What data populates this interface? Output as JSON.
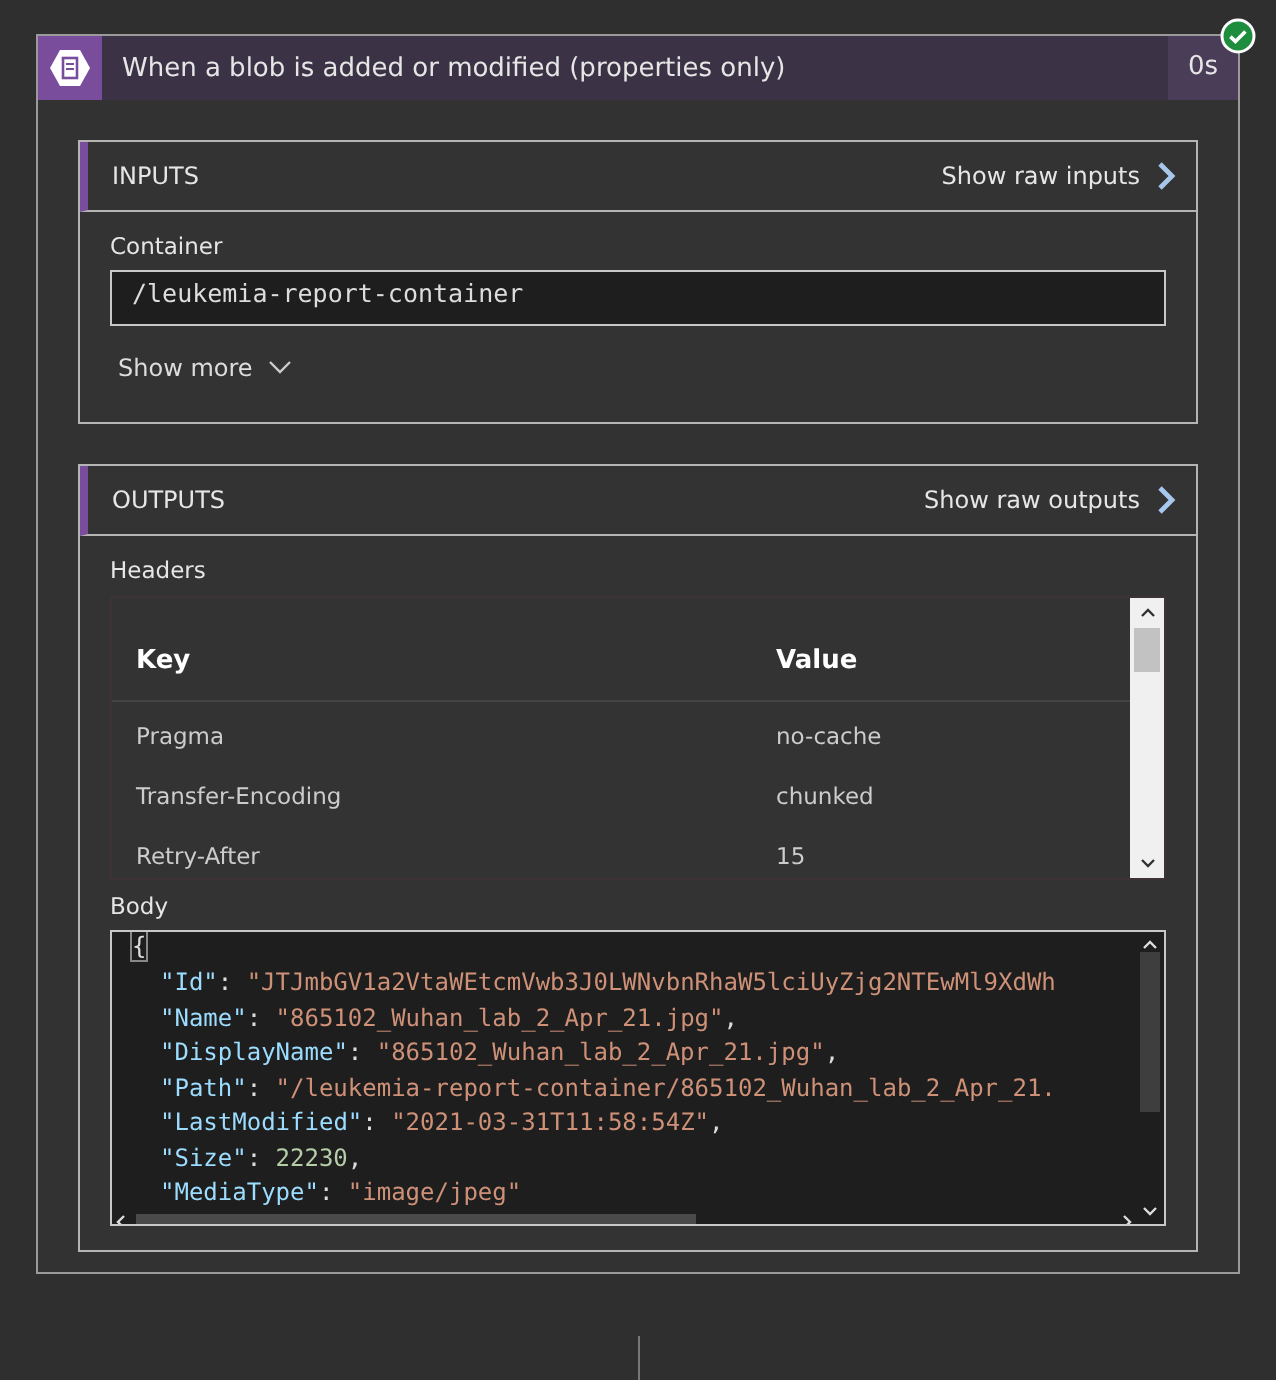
{
  "step": {
    "title": "When a blob is added or modified (properties only)",
    "duration": "0s",
    "succeeded": true
  },
  "inputs": {
    "heading": "INPUTS",
    "raw_link": "Show raw inputs",
    "field_label": "Container",
    "field_value": "/leukemia-report-container",
    "show_more": "Show more"
  },
  "outputs": {
    "heading": "OUTPUTS",
    "raw_link": "Show raw outputs",
    "headers_label": "Headers",
    "headers_table": {
      "columns": [
        "Key",
        "Value"
      ],
      "rows": [
        {
          "key": "Pragma",
          "value": "no-cache"
        },
        {
          "key": "Transfer-Encoding",
          "value": "chunked"
        },
        {
          "key": "Retry-After",
          "value": "15"
        }
      ]
    },
    "body_label": "Body",
    "body_open": "{",
    "body_lines": [
      {
        "key": "\"Id\"",
        "sep": ":",
        "value": "\"JTJmbGV1a2VtaWEtcmVwb3J0LWNvbnRhaW5lciUyZjg2NTEwMl9XdWh",
        "kind": "string"
      },
      {
        "key": "\"Name\"",
        "sep": ":",
        "value": "\"865102_Wuhan_lab_2_Apr_21.jpg\"",
        "kind": "string",
        "tail": ","
      },
      {
        "key": "\"DisplayName\"",
        "sep": ":",
        "value": "\"865102_Wuhan_lab_2_Apr_21.jpg\"",
        "kind": "string",
        "tail": ","
      },
      {
        "key": "\"Path\"",
        "sep": ":",
        "value": "\"/leukemia-report-container/865102_Wuhan_lab_2_Apr_21.",
        "kind": "string"
      },
      {
        "key": "\"LastModified\"",
        "sep": ":",
        "value": "\"2021-03-31T11:58:54Z\"",
        "kind": "string",
        "tail": ","
      },
      {
        "key": "\"Size\"",
        "sep": ":",
        "value": "22230",
        "kind": "number",
        "tail": ","
      },
      {
        "key": "\"MediaType\"",
        "sep": ":",
        "value": "\"image/jpeg\"",
        "kind": "string"
      }
    ]
  }
}
